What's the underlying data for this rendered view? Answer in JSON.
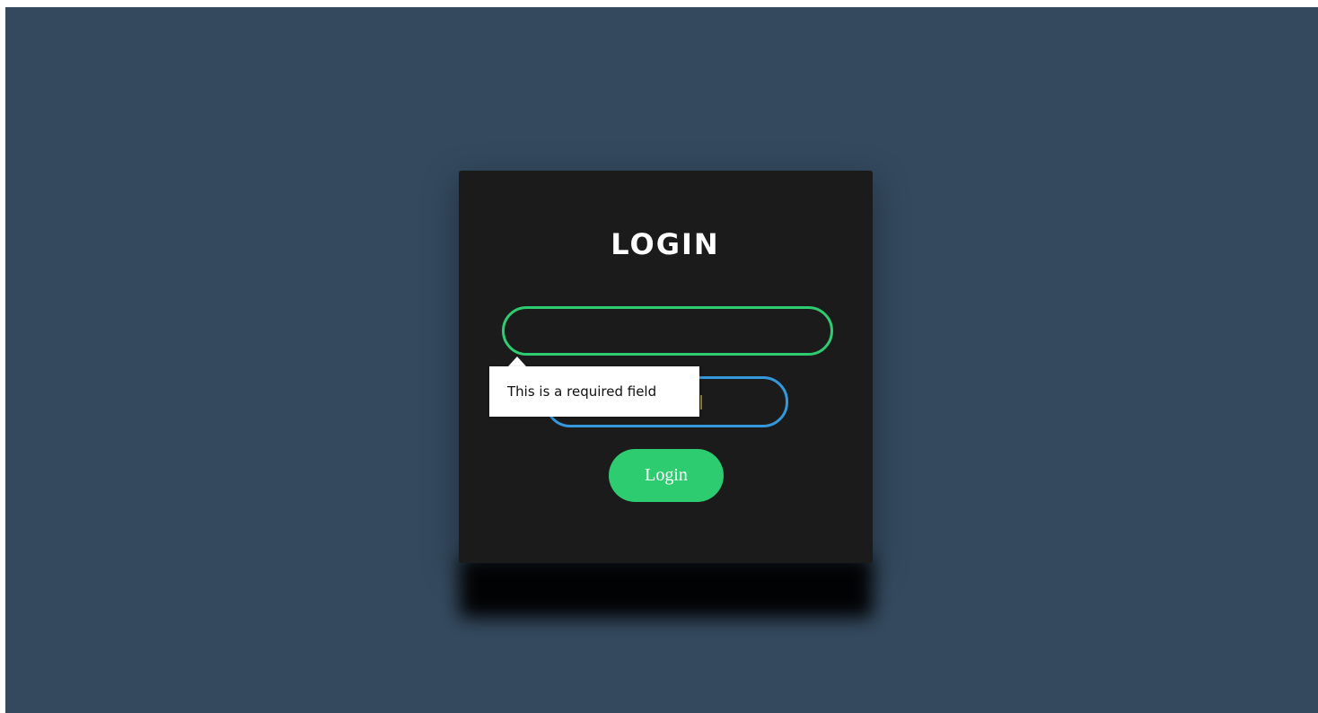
{
  "login_card": {
    "title": "LOGIN",
    "username_input": {
      "value": "",
      "placeholder": ""
    },
    "password_input": {
      "value": "",
      "placeholder": ""
    },
    "submit_label": "Login"
  },
  "validation_tooltip": {
    "message": "This is a required field"
  },
  "colors": {
    "page_background": "#34495e",
    "card_background": "#1b1b1b",
    "username_border": "#2ecc71",
    "password_border": "#3498db",
    "button_background": "#2ecc71",
    "tooltip_background": "#ffffff"
  }
}
